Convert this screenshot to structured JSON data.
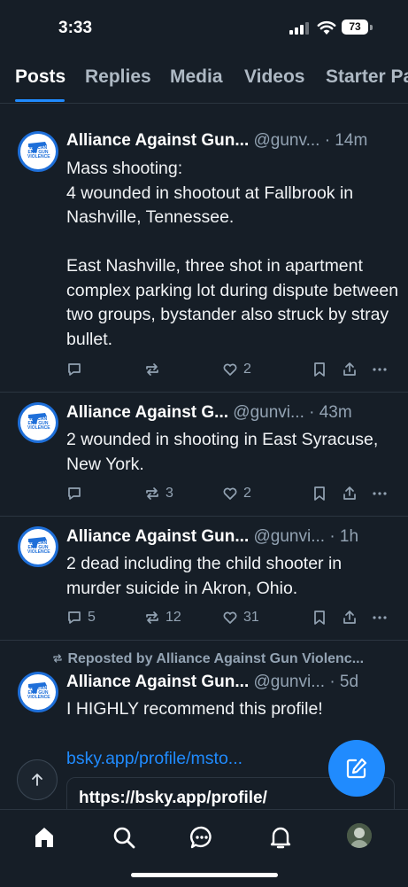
{
  "status_bar": {
    "time": "3:33",
    "battery": "73"
  },
  "tabs": [
    {
      "label": "Posts",
      "active": true
    },
    {
      "label": "Replies",
      "active": false
    },
    {
      "label": "Media",
      "active": false
    },
    {
      "label": "Videos",
      "active": false
    },
    {
      "label": "Starter Pa",
      "active": false
    }
  ],
  "posts": [
    {
      "name": "Alliance Against Gun...",
      "handle": "@gunv...",
      "time": "· 14m",
      "text": "Mass shooting:\n4 wounded in shootout at Fallbrook in Nashville, Tennessee.\n\nEast Nashville, three shot in apartment complex parking lot during dispute between two groups, bystander also struck by stray bullet.",
      "replies": "",
      "reposts": "",
      "likes": "2"
    },
    {
      "name": "Alliance Against G...",
      "handle": "@gunvi...",
      "time": "· 43m",
      "text": "2 wounded in shooting in East Syracuse, New York.",
      "replies": "",
      "reposts": "3",
      "likes": "2"
    },
    {
      "name": "Alliance Against Gun...",
      "handle": "@gunvi...",
      "time": "· 1h",
      "text": "2 dead including the child shooter in murder suicide in Akron, Ohio.",
      "replies": "5",
      "reposts": "12",
      "likes": "31"
    },
    {
      "repost_label": "Reposted by Alliance Against Gun Violenc...",
      "name": "Alliance Against Gun...",
      "handle": "@gunvi...",
      "time": "· 5d",
      "text": "I HIGHLY recommend this profile!",
      "link": "bsky.app/profile/msto...",
      "card_url": "https://bsky.app/profile/"
    }
  ],
  "avatar_text": "WE CAN END GUN VIOLENCE",
  "colors": {
    "accent": "#208bfe",
    "background": "#161e27",
    "muted": "#93a3b3"
  }
}
